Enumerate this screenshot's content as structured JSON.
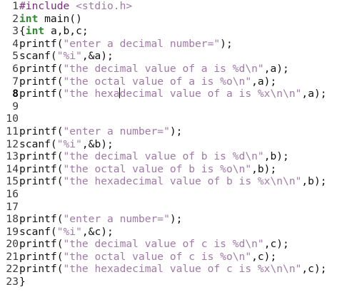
{
  "editor": {
    "current_line": 8,
    "lines": [
      {
        "n": "1",
        "tokens": [
          {
            "t": "#include ",
            "c": "pre"
          },
          {
            "t": "<stdio.h>",
            "c": "inc"
          }
        ]
      },
      {
        "n": "2",
        "tokens": [
          {
            "t": "int",
            "c": "kw"
          },
          {
            "t": " main()",
            "c": "plain"
          }
        ]
      },
      {
        "n": "3",
        "tokens": [
          {
            "t": "{",
            "c": "plain"
          },
          {
            "t": "int",
            "c": "kw"
          },
          {
            "t": " a,b,c;",
            "c": "plain"
          }
        ]
      },
      {
        "n": "4",
        "tokens": [
          {
            "t": "printf(",
            "c": "plain"
          },
          {
            "t": "\"enter a decimal number=\"",
            "c": "str"
          },
          {
            "t": ");",
            "c": "plain"
          }
        ]
      },
      {
        "n": "5",
        "tokens": [
          {
            "t": "scanf(",
            "c": "plain"
          },
          {
            "t": "\"%i\"",
            "c": "str"
          },
          {
            "t": ",&a);",
            "c": "plain"
          }
        ]
      },
      {
        "n": "6",
        "tokens": [
          {
            "t": "printf(",
            "c": "plain"
          },
          {
            "t": "\"the decimal value of a is %d\\n\"",
            "c": "str"
          },
          {
            "t": ",a);",
            "c": "plain"
          }
        ]
      },
      {
        "n": "7",
        "tokens": [
          {
            "t": "printf(",
            "c": "plain"
          },
          {
            "t": "\"the octal value of a is %o\\n\"",
            "c": "str"
          },
          {
            "t": ",a);",
            "c": "plain"
          }
        ]
      },
      {
        "n": "8",
        "tokens": [
          {
            "t": "printf(",
            "c": "plain"
          },
          {
            "t": "\"the hexa",
            "c": "str"
          },
          {
            "t": "|",
            "c": "cursor"
          },
          {
            "t": "decimal value of a is %x\\n\\n\"",
            "c": "str"
          },
          {
            "t": ",a);",
            "c": "plain"
          }
        ]
      },
      {
        "n": "9",
        "tokens": []
      },
      {
        "n": "10",
        "tokens": []
      },
      {
        "n": "11",
        "tokens": [
          {
            "t": "printf(",
            "c": "plain"
          },
          {
            "t": "\"enter a number=\"",
            "c": "str"
          },
          {
            "t": ");",
            "c": "plain"
          }
        ]
      },
      {
        "n": "12",
        "tokens": [
          {
            "t": "scanf(",
            "c": "plain"
          },
          {
            "t": "\"%i\"",
            "c": "str"
          },
          {
            "t": ",&b);",
            "c": "plain"
          }
        ]
      },
      {
        "n": "13",
        "tokens": [
          {
            "t": "printf(",
            "c": "plain"
          },
          {
            "t": "\"the decimal value of b is %d\\n\"",
            "c": "str"
          },
          {
            "t": ",b);",
            "c": "plain"
          }
        ]
      },
      {
        "n": "14",
        "tokens": [
          {
            "t": "printf(",
            "c": "plain"
          },
          {
            "t": "\"the octal value of b is %o\\n\"",
            "c": "str"
          },
          {
            "t": ",b);",
            "c": "plain"
          }
        ]
      },
      {
        "n": "15",
        "tokens": [
          {
            "t": "printf(",
            "c": "plain"
          },
          {
            "t": "\"the hexadecimal value of b is %x\\n\\n\"",
            "c": "str"
          },
          {
            "t": ",b);",
            "c": "plain"
          }
        ]
      },
      {
        "n": "16",
        "tokens": []
      },
      {
        "n": "17",
        "tokens": []
      },
      {
        "n": "18",
        "tokens": [
          {
            "t": "printf(",
            "c": "plain"
          },
          {
            "t": "\"enter a number=\"",
            "c": "str"
          },
          {
            "t": ");",
            "c": "plain"
          }
        ]
      },
      {
        "n": "19",
        "tokens": [
          {
            "t": "scanf(",
            "c": "plain"
          },
          {
            "t": "\"%i\"",
            "c": "str"
          },
          {
            "t": ",&c);",
            "c": "plain"
          }
        ]
      },
      {
        "n": "20",
        "tokens": [
          {
            "t": "printf(",
            "c": "plain"
          },
          {
            "t": "\"the decimal value of c is %d\\n\"",
            "c": "str"
          },
          {
            "t": ",c);",
            "c": "plain"
          }
        ]
      },
      {
        "n": "21",
        "tokens": [
          {
            "t": "printf(",
            "c": "plain"
          },
          {
            "t": "\"the octal value of c is %o\\n\"",
            "c": "str"
          },
          {
            "t": ",c);",
            "c": "plain"
          }
        ]
      },
      {
        "n": "22",
        "tokens": [
          {
            "t": "printf(",
            "c": "plain"
          },
          {
            "t": "\"the hexadecimal value of c is %x\\n\\n\"",
            "c": "str"
          },
          {
            "t": ",c);",
            "c": "plain"
          }
        ]
      },
      {
        "n": "23",
        "tokens": [
          {
            "t": "}",
            "c": "plain"
          }
        ]
      }
    ]
  }
}
